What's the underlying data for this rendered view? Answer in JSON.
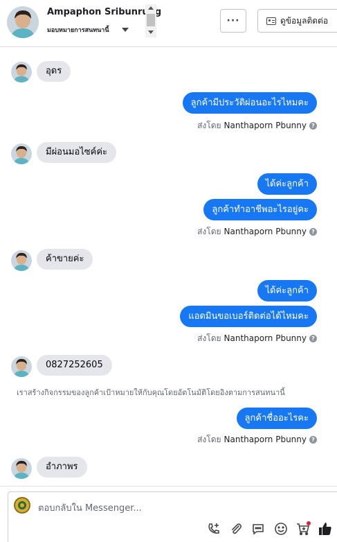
{
  "header": {
    "name": "Ampaphon Sribunrung",
    "subtitle": "มอบหมายการสนทนานี้",
    "more_label": "···",
    "contact_button_label": "ดูข้อมูลติดต่อ"
  },
  "messages": [
    {
      "dir": "in",
      "text": "อุดร"
    },
    {
      "dir": "out",
      "text": "ลูกค้ามีประวัติผ่อนอะไรไหมคะ"
    },
    {
      "dir": "in",
      "text": "มีผ่อนมอไซค์ค่ะ"
    },
    {
      "dir": "out",
      "text": "ได้ค่ะลูกค้า"
    },
    {
      "dir": "out",
      "text": "ลูกค้าทำอาชีพอะไรอยู่คะ"
    },
    {
      "dir": "in",
      "text": "ค้าขายค่ะ"
    },
    {
      "dir": "out",
      "text": "ได้ค่ะลูกค้า"
    },
    {
      "dir": "out",
      "text": "แอดมินขอเบอร์ติดต่อได้ไหมคะ"
    },
    {
      "dir": "in",
      "text": "0827252605"
    },
    {
      "dir": "out",
      "text": "ลูกค้าชื่ออะไรคะ"
    },
    {
      "dir": "in",
      "text": "อำภาพร"
    }
  ],
  "sent_by": {
    "prefix": "ส่งโดย",
    "agent": "Nanthaporn Pbunny",
    "info": "?"
  },
  "system_note": "เราสร้างกิจกรรมของลูกค้าเป้าหมายให้กับคุณโดยอัตโนมัติโดยอิงตามการสนทนานี้",
  "composer": {
    "placeholder": "ตอบกลับใน Messenger..."
  },
  "colors": {
    "outgoing_bubble": "#1877f2",
    "incoming_bubble": "#e4e6eb",
    "like_button": "#1c1e21",
    "notification_dot": "#e41e3f"
  },
  "icons": [
    "more-icon",
    "contact-card-icon",
    "add-call-icon",
    "attachment-icon",
    "saved-reply-icon",
    "emoji-icon",
    "cart-icon",
    "like-icon"
  ]
}
